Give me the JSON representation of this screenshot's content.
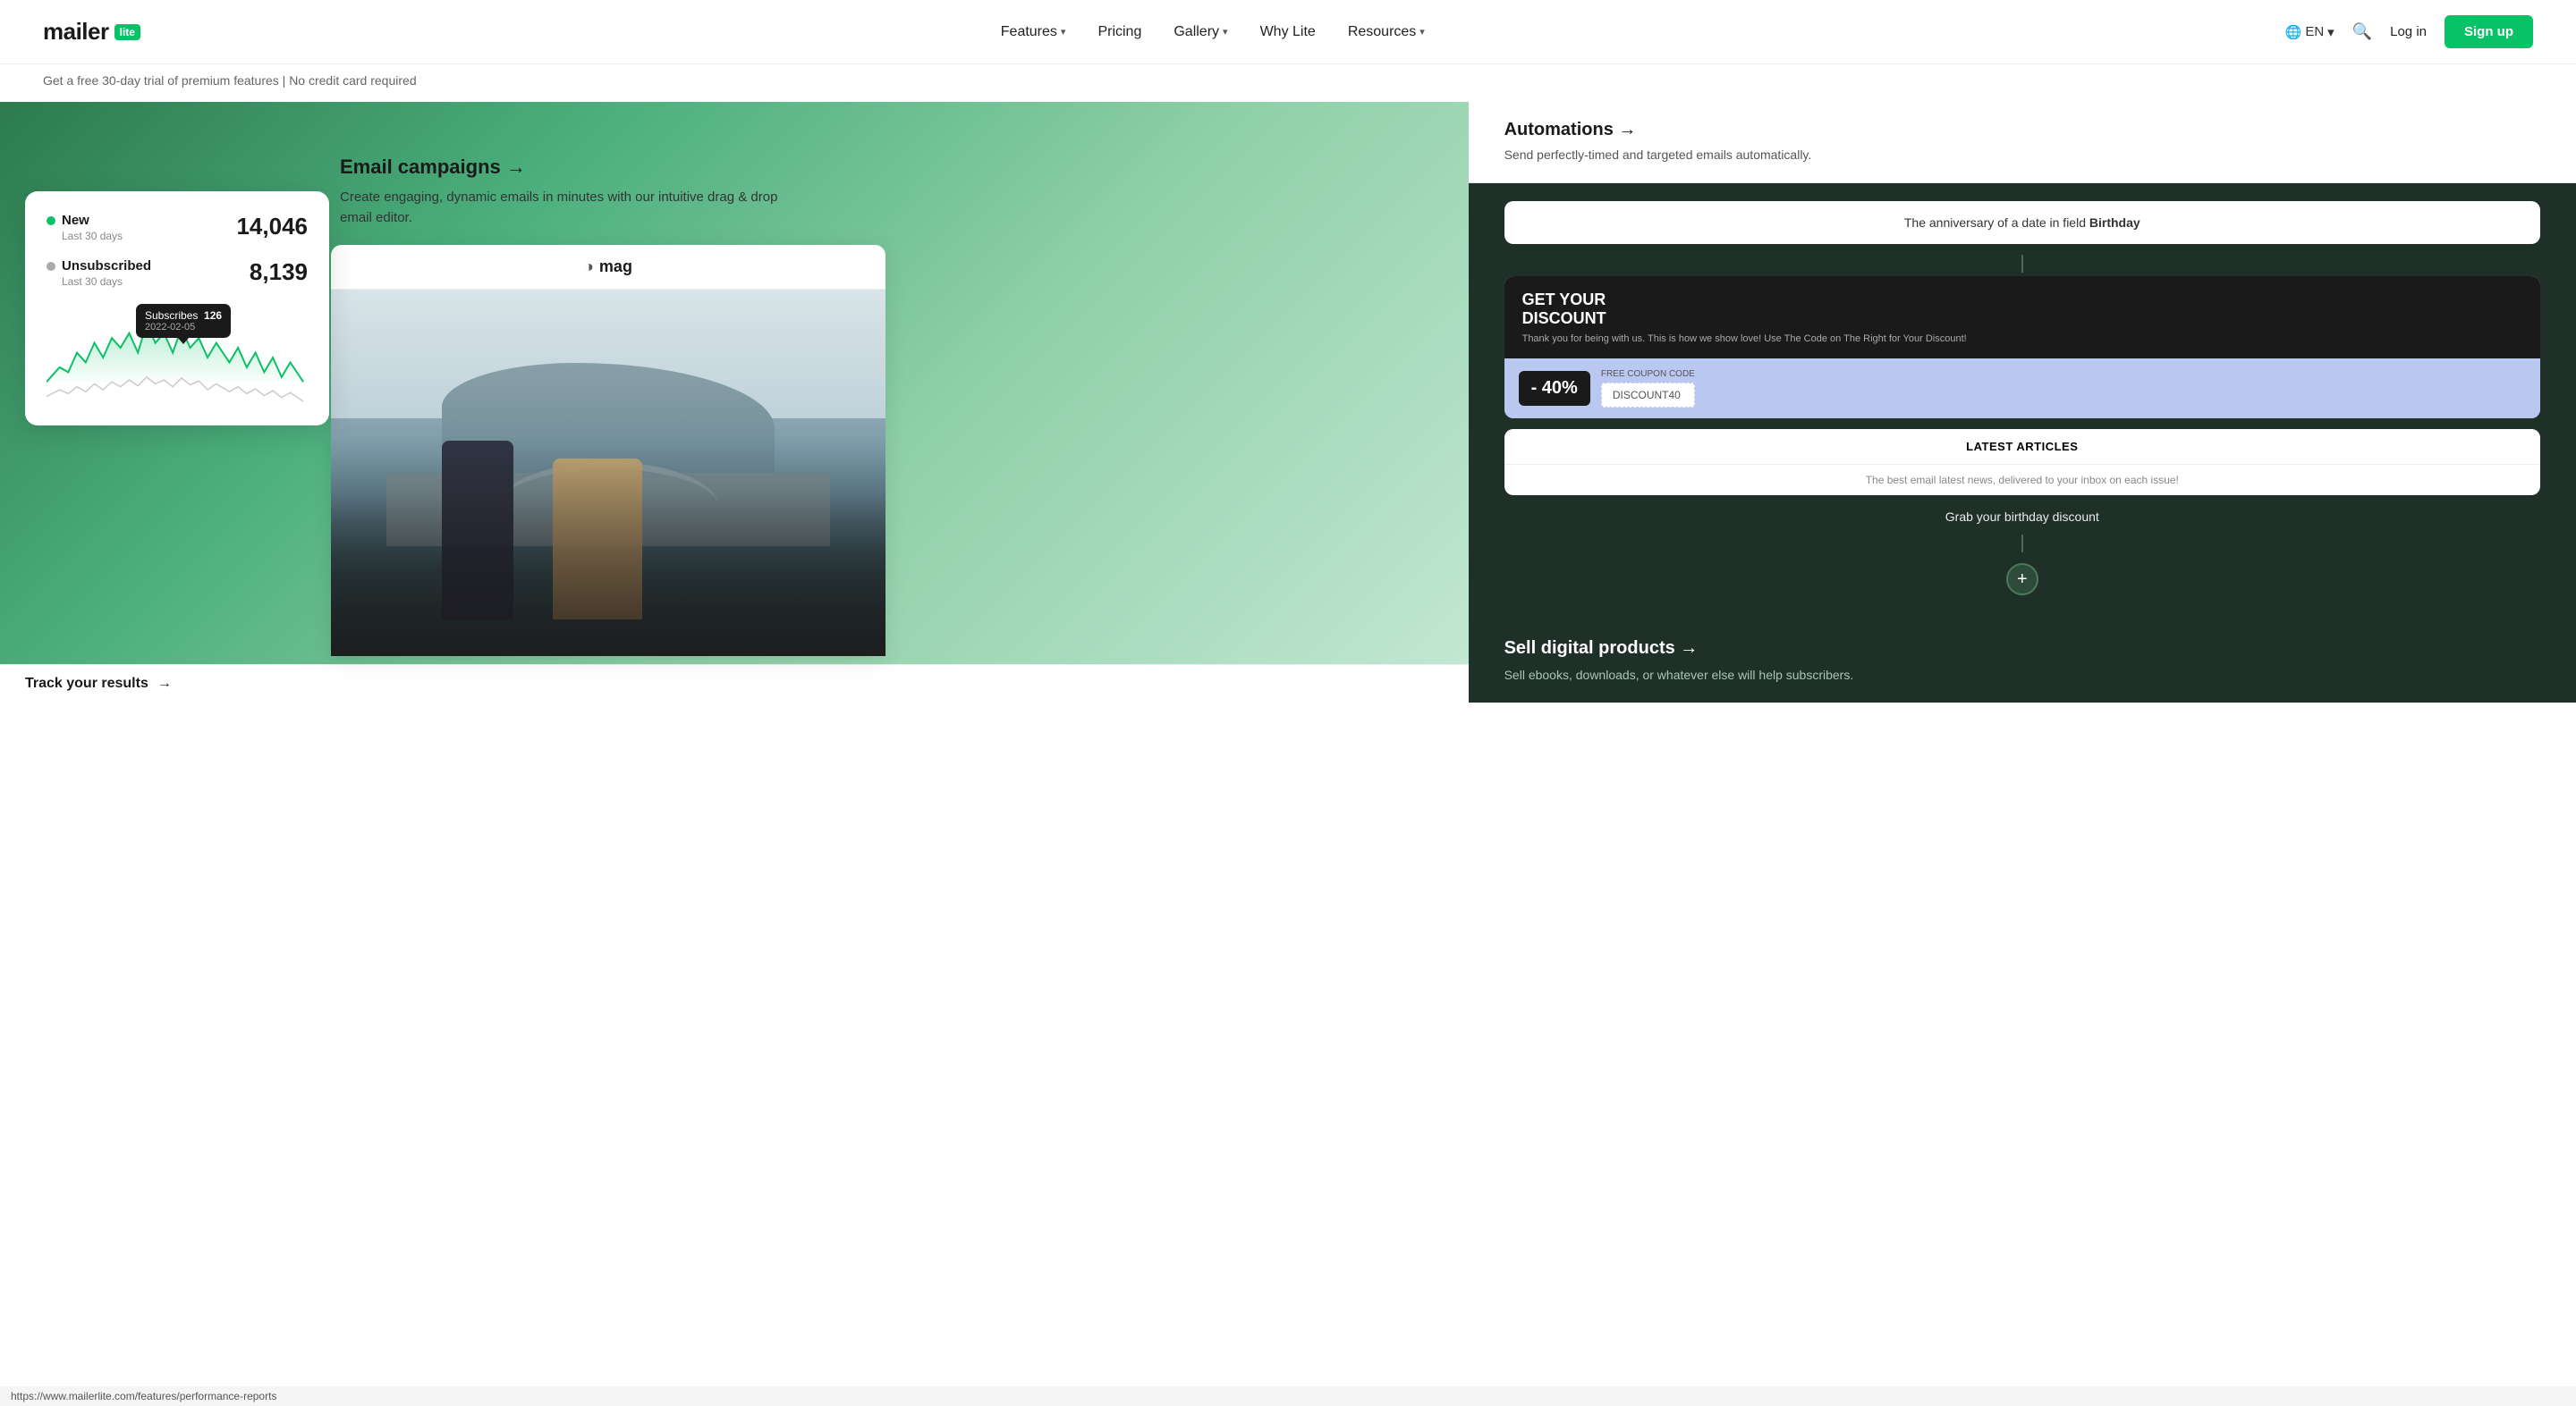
{
  "nav": {
    "logo_text": "mailer",
    "logo_badge": "lite",
    "links": [
      {
        "label": "Features",
        "has_arrow": true
      },
      {
        "label": "Pricing",
        "has_arrow": false
      },
      {
        "label": "Gallery",
        "has_arrow": true
      },
      {
        "label": "Why Lite",
        "has_arrow": false
      },
      {
        "label": "Resources",
        "has_arrow": true
      }
    ],
    "lang": "EN",
    "login_label": "Log in",
    "signup_label": "Sign up"
  },
  "trial_bar": {
    "text": "Get a free 30-day trial of premium features | No credit card required"
  },
  "dashboard": {
    "new_label": "New",
    "new_sublabel": "Last 30 days",
    "new_value": "14,046",
    "unsub_label": "Unsubscribed",
    "unsub_sublabel": "Last 30 days",
    "unsub_value": "8,139",
    "tooltip_label": "Subscribes",
    "tooltip_value": "126",
    "tooltip_date": "2022-02-05"
  },
  "track": {
    "label": "Track your results",
    "arrow": "→",
    "url": "https://www.mailerlite.com/features/performance-reports"
  },
  "email_campaigns": {
    "title": "Email campaigns →",
    "desc": "Create engaging, dynamic emails in minutes with our intuitive drag & drop email editor."
  },
  "email_preview": {
    "logo": "mag",
    "moon": "◑"
  },
  "automations": {
    "title": "Automations →",
    "desc": "Send perfectly-timed and targeted emails automatically."
  },
  "flow": {
    "trigger_text": "The anniversary of a date in field",
    "trigger_field": "Birthday"
  },
  "email_visual": {
    "header_line1": "GET YOUR",
    "header_line2": "DISCOUNT",
    "discount": "- 40%",
    "coupon_code": "DISCOUNT40",
    "articles_header": "LATEST ARTICLES",
    "articles_body": "The best email latest news, delivered to your inbox on each issue!",
    "birthday_link": "Grab your birthday discount"
  },
  "flow_plus": "+",
  "sell_digital": {
    "title": "Sell digital products →",
    "desc": "Sell ebooks, downloads, or whatever else will help subscribers."
  }
}
